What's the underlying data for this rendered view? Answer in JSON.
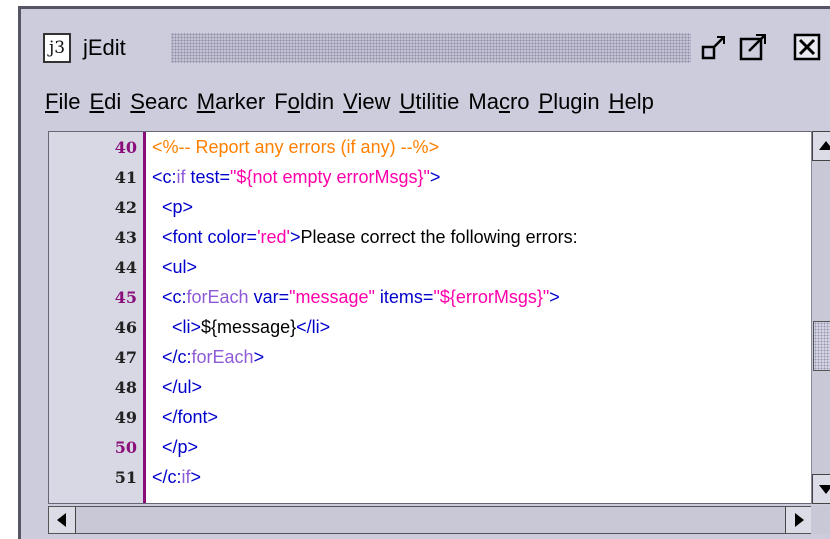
{
  "window": {
    "title": "jEdit",
    "app_icon_text": "j3"
  },
  "menubar": {
    "items": [
      {
        "label": "File",
        "mnemonic": "F",
        "rest": "ile"
      },
      {
        "label": "Edi",
        "mnemonic": "E",
        "rest": "di"
      },
      {
        "label": "Searc",
        "mnemonic": "S",
        "rest": "earc"
      },
      {
        "label": "Marker",
        "mnemonic": "M",
        "rest": "arker"
      },
      {
        "label": "Foldin",
        "pre": "F",
        "mnemonic": "o",
        "rest": "ldin"
      },
      {
        "label": "View",
        "mnemonic": "V",
        "rest": "iew"
      },
      {
        "label": "Utilitie",
        "mnemonic": "U",
        "rest": "tilitie"
      },
      {
        "label": "Macro",
        "pre": "Ma",
        "mnemonic": "c",
        "rest": "ro"
      },
      {
        "label": "Plugin",
        "mnemonic": "P",
        "rest": "lugin"
      },
      {
        "label": "Help",
        "mnemonic": "H",
        "rest": "elp"
      }
    ]
  },
  "editor": {
    "line_numbers": [
      "40",
      "41",
      "42",
      "43",
      "44",
      "45",
      "46",
      "47",
      "48",
      "49",
      "50",
      "51"
    ],
    "lines": [
      {
        "segments": [
          {
            "t": "<%-- Report any errors (if any) --%>",
            "c": "comment"
          }
        ]
      },
      {
        "segments": [
          {
            "t": "<c:",
            "c": "tag"
          },
          {
            "t": "if",
            "c": "tagns"
          },
          {
            "t": " test=",
            "c": "attr"
          },
          {
            "t": "\"${not empty errorMsgs}\"",
            "c": "str"
          },
          {
            "t": ">",
            "c": "tag"
          }
        ]
      },
      {
        "segments": [
          {
            "t": "  <p>",
            "c": "tag"
          }
        ]
      },
      {
        "segments": [
          {
            "t": "  <font color=",
            "c": "tag"
          },
          {
            "t": "'red'",
            "c": "str"
          },
          {
            "t": ">",
            "c": "tag"
          },
          {
            "t": "Please correct the following errors:",
            "c": "text"
          }
        ]
      },
      {
        "segments": [
          {
            "t": "  <ul>",
            "c": "tag"
          }
        ]
      },
      {
        "segments": [
          {
            "t": "  <c:",
            "c": "tag"
          },
          {
            "t": "forEach",
            "c": "tagns"
          },
          {
            "t": " var=",
            "c": "attr"
          },
          {
            "t": "\"message\"",
            "c": "str"
          },
          {
            "t": " items=",
            "c": "attr"
          },
          {
            "t": "\"${errorMsgs}\"",
            "c": "str"
          },
          {
            "t": ">",
            "c": "tag"
          }
        ]
      },
      {
        "segments": [
          {
            "t": "    <li>",
            "c": "tag"
          },
          {
            "t": "${message}",
            "c": "text"
          },
          {
            "t": "</li>",
            "c": "tag"
          }
        ]
      },
      {
        "segments": [
          {
            "t": "  </c:",
            "c": "tag"
          },
          {
            "t": "forEach",
            "c": "tagns"
          },
          {
            "t": ">",
            "c": "tag"
          }
        ]
      },
      {
        "segments": [
          {
            "t": "  </ul>",
            "c": "tag"
          }
        ]
      },
      {
        "segments": [
          {
            "t": "  </font>",
            "c": "tag"
          }
        ]
      },
      {
        "segments": [
          {
            "t": "  </p>",
            "c": "tag"
          }
        ]
      },
      {
        "segments": [
          {
            "t": "</c:",
            "c": "tag"
          },
          {
            "t": "if",
            "c": "tagns"
          },
          {
            "t": ">",
            "c": "tag"
          }
        ]
      }
    ],
    "folded_lines": [
      "40",
      "45",
      "50"
    ]
  },
  "colors": {
    "comment": "#ff8000",
    "tag": "#0000cc",
    "tag_namespace": "#8f5ad8",
    "string": "#ff00aa",
    "gutter_marker": "#8a0f7a"
  },
  "icons": {
    "minimize": "minimize-icon",
    "maximize": "maximize-icon",
    "close": "close-icon",
    "scroll_up": "arrow-up-icon",
    "scroll_down": "arrow-down-icon",
    "scroll_left": "arrow-left-icon",
    "scroll_right": "arrow-right-icon"
  }
}
